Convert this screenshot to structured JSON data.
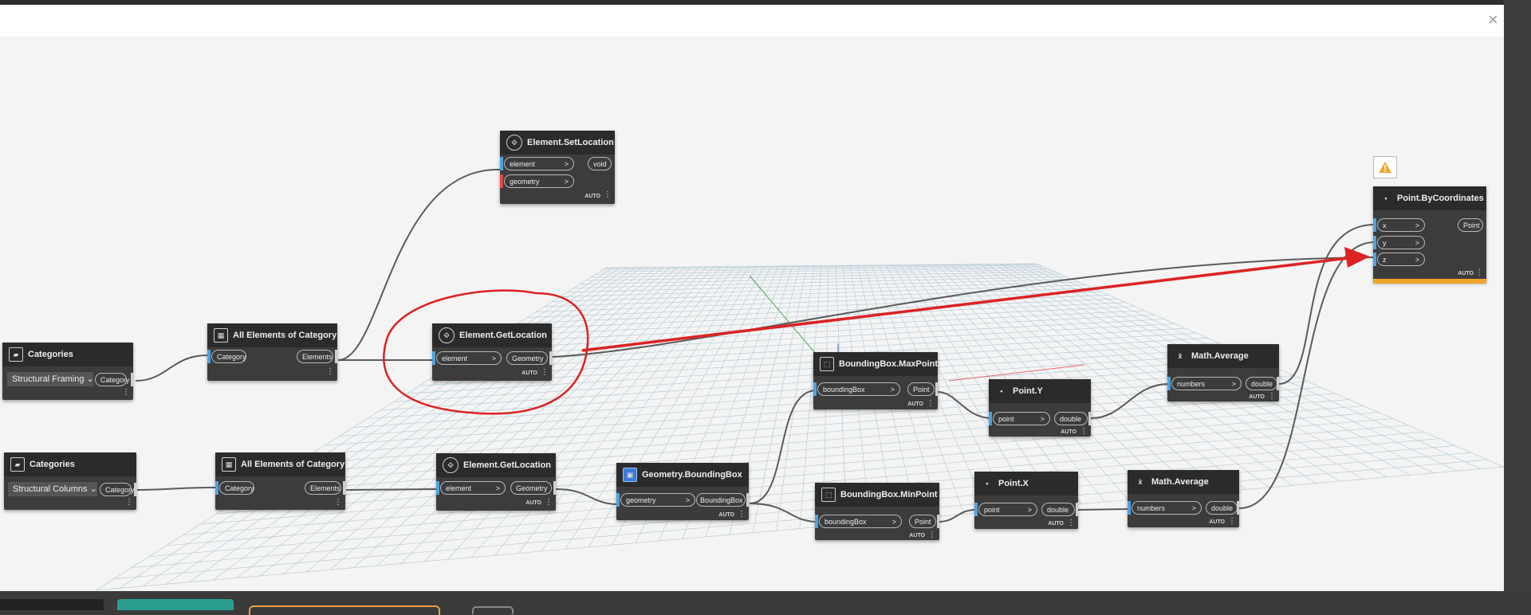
{
  "window": {
    "close_glyph": "×"
  },
  "colors": {
    "canvas": "#f4f4f4",
    "node": "#3c3c3c",
    "input_port": "#4da3e0",
    "warning": "#f0a52b",
    "annotation": "#dd2222"
  },
  "nodes": {
    "categories_framing": {
      "title": "Categories",
      "dropdown": "Structural Framing",
      "out": "Category",
      "icon": "category-icon"
    },
    "categories_columns": {
      "title": "Categories",
      "dropdown": "Structural Columns",
      "out": "Category",
      "icon": "category-icon"
    },
    "all_elements_1": {
      "title": "All Elements of Category",
      "in": "Category",
      "out": "Elements",
      "icon": "elements-icon"
    },
    "all_elements_2": {
      "title": "All Elements of Category",
      "in": "Category",
      "out": "Elements",
      "icon": "elements-icon"
    },
    "set_location": {
      "title": "Element.SetLocation",
      "in1": "element",
      "in2": "geometry",
      "out": "void",
      "auto": "AUTO",
      "icon": "element-icon"
    },
    "get_location_1": {
      "title": "Element.GetLocation",
      "in": "element",
      "out": "Geometry",
      "auto": "AUTO",
      "icon": "element-icon"
    },
    "get_location_2": {
      "title": "Element.GetLocation",
      "in": "element",
      "out": "Geometry",
      "auto": "AUTO",
      "icon": "element-icon"
    },
    "bounding_box": {
      "title": "Geometry.BoundingBox",
      "in": "geometry",
      "out": "BoundingBox",
      "auto": "AUTO",
      "icon": "bounding-box-icon"
    },
    "max_point": {
      "title": "BoundingBox.MaxPoint",
      "in": "boundingBox",
      "out": "Point",
      "auto": "AUTO",
      "icon": "max-point-icon"
    },
    "min_point": {
      "title": "BoundingBox.MinPoint",
      "in": "boundingBox",
      "out": "Point",
      "auto": "AUTO",
      "icon": "min-point-icon"
    },
    "point_y": {
      "title": "Point.Y",
      "in": "point",
      "out": "double",
      "auto": "AUTO",
      "icon": "point-icon"
    },
    "point_x": {
      "title": "Point.X",
      "in": "point",
      "out": "double",
      "auto": "AUTO",
      "icon": "point-icon"
    },
    "average_1": {
      "title": "Math.Average",
      "in": "numbers",
      "out": "double",
      "auto": "AUTO",
      "icon": "average-icon"
    },
    "average_2": {
      "title": "Math.Average",
      "in": "numbers",
      "out": "double",
      "auto": "AUTO",
      "icon": "average-icon"
    },
    "point_by_coords": {
      "title": "Point.ByCoordinates",
      "in1": "x",
      "in2": "y",
      "in3": "z",
      "out": "Point",
      "auto": "AUTO",
      "icon": "point-icon",
      "warning_icon": "warning-icon"
    }
  },
  "glyphs": {
    "chevron": ">",
    "dropdown_arrow": "⌄",
    "menu": "⋮"
  }
}
